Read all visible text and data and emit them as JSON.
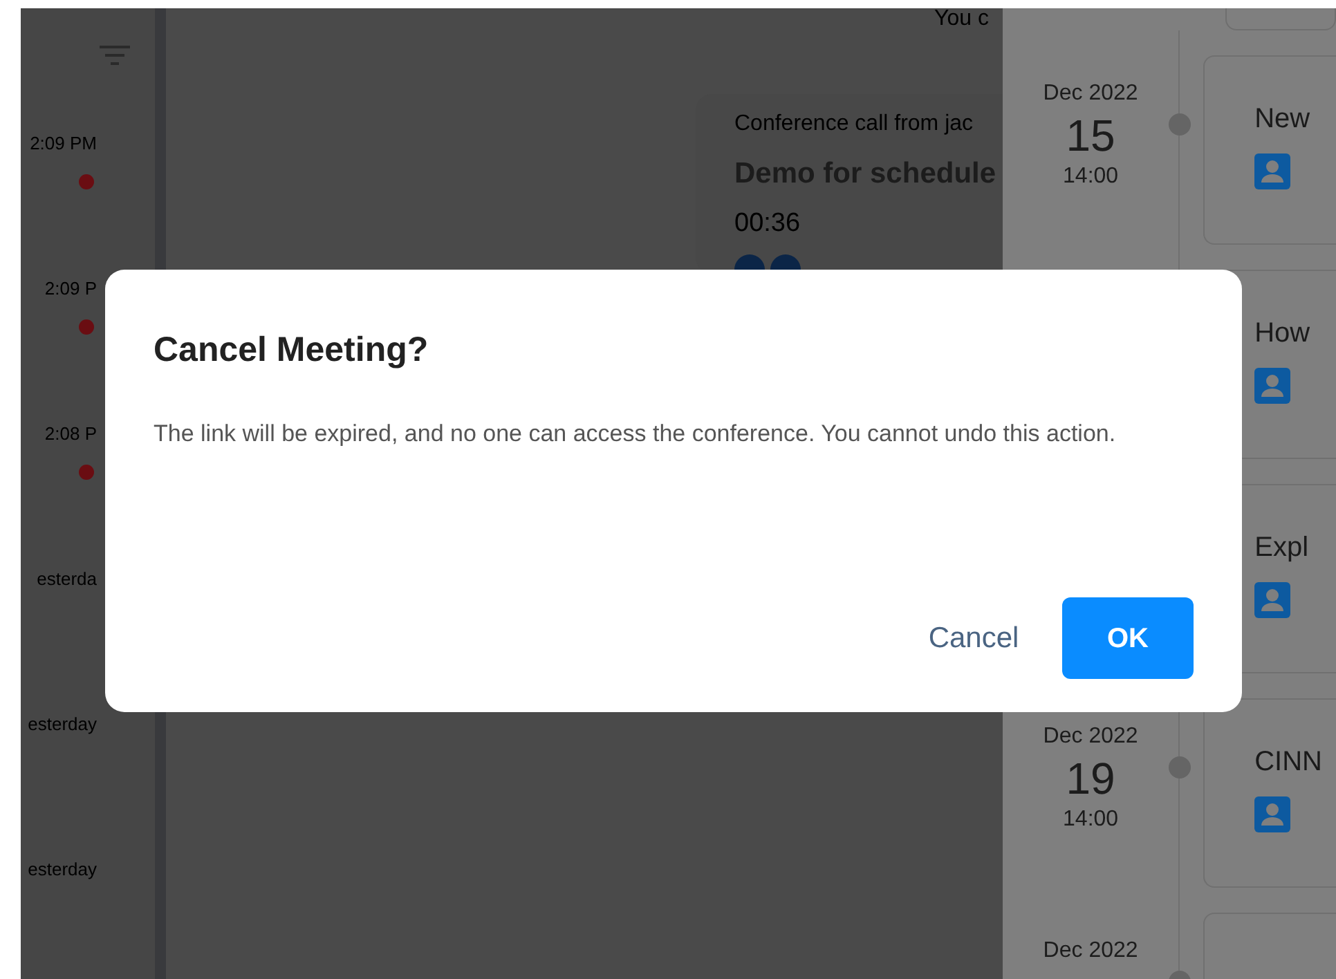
{
  "call_list": {
    "items": [
      {
        "time": "2:09 PM",
        "unread": true
      },
      {
        "time": "2:09 P",
        "unread": true
      },
      {
        "time": "2:08 P",
        "unread": true
      },
      {
        "time": "esterda",
        "unread": false
      },
      {
        "time": "esterday",
        "unread": false
      },
      {
        "time": "esterday",
        "unread": false
      }
    ]
  },
  "detail": {
    "header_text": "You c",
    "call_card": {
      "subtitle": "Conference call from jac",
      "title": "Demo for schedule",
      "duration": "00:36"
    }
  },
  "schedule": [
    {
      "title": "New",
      "month": "Dec 2022",
      "day": "15",
      "time": "14:00"
    },
    {
      "title": "How"
    },
    {
      "title": "Expl"
    },
    {
      "title": "CINN",
      "month": "Dec 2022",
      "day": "19",
      "time": "14:00"
    },
    {
      "month": "Dec 2022"
    }
  ],
  "dialog": {
    "title": "Cancel Meeting?",
    "message": "The link will be expired, and no one can access the conference. You cannot undo this action.",
    "buttons": [
      {
        "label": "Cancel",
        "kind": "text"
      },
      {
        "label": "OK",
        "kind": "primary"
      }
    ]
  }
}
